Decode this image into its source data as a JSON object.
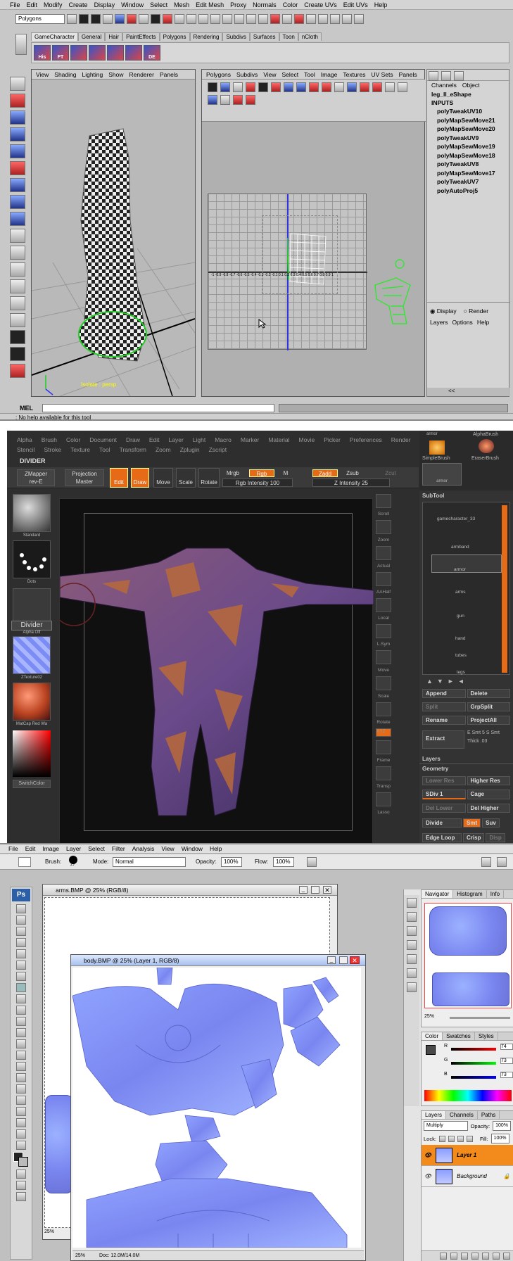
{
  "maya": {
    "menu": [
      "File",
      "Edit",
      "Modify",
      "Create",
      "Display",
      "Window",
      "Select",
      "Mesh",
      "Edit Mesh",
      "Proxy",
      "Normals",
      "Color",
      "Create UVs",
      "Edit UVs",
      "Help"
    ],
    "mode_select": "Polygons",
    "shelf_tabs": [
      "GameCharacter",
      "General",
      "Hair",
      "PaintEffects",
      "Polygons",
      "Rendering",
      "Subdivs",
      "Surfaces",
      "Toon",
      "nCloth"
    ],
    "shelf_icons": [
      "His",
      "FT",
      "",
      "",
      "",
      "",
      "DE"
    ],
    "viewport_menu": [
      "View",
      "Shading",
      "Lighting",
      "Show",
      "Renderer",
      "Panels"
    ],
    "viewport_label": "Isolate : persp",
    "uv_menu": [
      "Polygons",
      "Subdivs",
      "View",
      "Select",
      "Tool",
      "Image",
      "Textures",
      "UV Sets",
      "Panels"
    ],
    "uv_ticks_left": [
      "1",
      "0.9",
      "0.8",
      "0.7",
      "0.6",
      "0.5",
      "0.4",
      "0.3",
      "0.2",
      "0.1"
    ],
    "uv_axis_row": "-1 -0.9 -0.8 -0.7 -0.6 -0.5 -0.4 -0.3 -0.2 -0.1 0.1 0.2 0.3 0.4 0.5 0.6 0.7 0.8 0.9 1",
    "channels_tabs": [
      "Channels",
      "Object"
    ],
    "shape_name": "leg_ll_eShape",
    "inputs_label": "INPUTS",
    "inputs": [
      "polyTweakUV10",
      "polyMapSewMove21",
      "polyMapSewMove20",
      "polyTweakUV9",
      "polyMapSewMove19",
      "polyMapSewMove18",
      "polyTweakUV8",
      "polyMapSewMove17",
      "polyTweakUV7",
      "polyAutoProj5"
    ],
    "display_radio": "Display",
    "render_radio": "Render",
    "layer_menu": [
      "Layers",
      "Options",
      "Help"
    ],
    "mel_label": "MEL",
    "help_line": ": No help available for this tool",
    "scroll_arrows": "<<"
  },
  "zbrush": {
    "menu_row1": [
      "Alpha",
      "Brush",
      "Color",
      "Document",
      "Draw",
      "Edit",
      "Layer",
      "Light",
      "Macro",
      "Marker",
      "Material",
      "Movie",
      "Picker",
      "Preferences",
      "Render"
    ],
    "menu_row2": [
      "Stencil",
      "Stroke",
      "Texture",
      "Tool",
      "Transform",
      "Zoom",
      "Zplugin",
      "Zscript"
    ],
    "title": "DIVIDER",
    "zmapper": "ZMapper",
    "zmapper_sub": "rev-E",
    "projection": "Projection",
    "projection_sub": "Master",
    "edit": "Edit",
    "draw": "Draw",
    "move": "Move",
    "scale": "Scale",
    "rotate": "Rotate",
    "mrgb": "Mrgb",
    "rgb": "Rgb",
    "m": "M",
    "rgb_intensity": "Rgb Intensity 100",
    "zadd": "Zadd",
    "zsub": "Zsub",
    "zcut": "Zcut",
    "z_intensity": "Z Intensity 25",
    "left_labels": [
      "Standard",
      "Dots",
      "Alpha Off",
      "ZTexture02",
      "MatCap Red Wa"
    ],
    "divider_label": "Divider",
    "switch_color": "SwitchColor",
    "right_tools": [
      "Scroll",
      "Zoom",
      "Actual",
      "AAHalf",
      "Local",
      "L.Sym",
      "Move",
      "Scale",
      "Rotate",
      "XYZ",
      "",
      "Frame",
      "Transp",
      "Lasso"
    ],
    "brushes": [
      "SimpleBrush",
      "EraserBrush",
      "armor"
    ],
    "brush_top": "armor",
    "brush_alpha": "AlphaBrush",
    "subtool_title": "SubTool",
    "subtools": [
      "gamecharacter_33",
      "armband",
      "armor",
      "arms",
      "gun",
      "hand",
      "tubes",
      "legs"
    ],
    "buttons": [
      "Append",
      "Delete",
      "Split",
      "GrpSplit",
      "Rename",
      "ProjectAll"
    ],
    "extract": "Extract",
    "e_smt": "E Smt 5",
    "s_smt": "S Smt",
    "thick": "Thick .03",
    "layers": "Layers",
    "geometry": "Geometry",
    "lower_res": "Lower Res",
    "higher_res": "Higher Res",
    "sdiv": "SDiv 1",
    "cage": "Cage",
    "del_lower": "Del Lower",
    "del_higher": "Del Higher",
    "divide": "Divide",
    "smt": "Smt",
    "suv": "Suv",
    "edge_loop": "Edge Loop",
    "crisp": "Crisp",
    "disp": "Disp"
  },
  "photoshop": {
    "menu": [
      "File",
      "Edit",
      "Image",
      "Layer",
      "Select",
      "Filter",
      "Analysis",
      "View",
      "Window",
      "Help"
    ],
    "brush_label": "Brush:",
    "brush_size": "27",
    "mode_label": "Mode:",
    "mode_value": "Normal",
    "opacity_label": "Opacity:",
    "opacity_value": "100%",
    "flow_label": "Flow:",
    "flow_value": "100%",
    "ps_logo": "Ps",
    "win1_title": "arms.BMP @ 25% (RGB/8)",
    "win1_zoom": "25%",
    "win2_title": "body.BMP @ 25% (Layer 1, RGB/8)",
    "win2_zoom": "25%",
    "win2_doc": "Doc: 12.0M/14.0M",
    "nav_tabs": [
      "Navigator",
      "Histogram",
      "Info"
    ],
    "nav_zoom": "25%",
    "color_tabs": [
      "Color",
      "Swatches",
      "Styles"
    ],
    "r_label": "R",
    "r_value": "74",
    "g_label": "G",
    "g_value": "73",
    "b_label": "B",
    "b_value": "73",
    "layer_tabs": [
      "Layers",
      "Channels",
      "Paths"
    ],
    "blend_mode": "Multiply",
    "layer_opacity_label": "Opacity:",
    "layer_opacity": "100%",
    "lock_label": "Lock:",
    "fill_label": "Fill:",
    "fill_value": "100%",
    "layer1": "Layer 1",
    "background": "Background"
  }
}
